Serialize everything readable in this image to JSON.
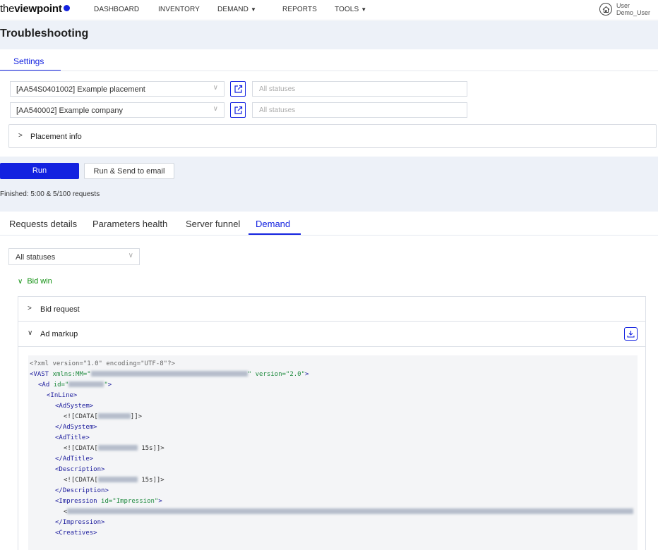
{
  "nav": {
    "logo_pre": "the",
    "logo_bold": "viewpoint",
    "items": [
      "DASHBOARD",
      "INVENTORY",
      "DEMAND",
      "REPORTS",
      "TOOLS"
    ],
    "user_label": "User",
    "user_name": "Demo_User"
  },
  "page": {
    "title": "Troubleshooting"
  },
  "settings": {
    "tab": "Settings",
    "placement_select": "[AA54S0401002] Example placement",
    "placement_status_placeholder": "All statuses",
    "company_select": "[AA540002] Example company",
    "company_status_placeholder": "All statuses",
    "placement_info": "Placement info"
  },
  "actions": {
    "run": "Run",
    "run_send": "Run & Send to email",
    "finished": "Finished: 5:00 & 5/100 requests"
  },
  "result_tabs": [
    "Requests details",
    "Parameters health",
    "Server funnel",
    "Demand"
  ],
  "active_tab": "Demand",
  "demand": {
    "status_filter": "All statuses",
    "group": "Bid win",
    "bid_request": "Bid request",
    "ad_markup": "Ad markup"
  },
  "code": {
    "xml_decl": "<?xml version=\"1.0\" encoding=\"UTF-8\"?>",
    "vast_open": "<VAST",
    "vast_attr1": "xmlns:MM=",
    "vast_attr2": "version=",
    "vast_version": "\"2.0\"",
    "ad_open": "<Ad",
    "ad_attr": "id=",
    "inline_open": "<InLine>",
    "adsystem_open": "<AdSystem>",
    "cdata_open": "<![CDATA[",
    "cdata_close": "]]>",
    "adsystem_close": "</AdSystem>",
    "adtitle_open": "<AdTitle>",
    "adtitle_suffix": " 15s]]>",
    "adtitle_close": "</AdTitle>",
    "description_open": "<Description>",
    "description_suffix": " 15s]]>",
    "description_close": "</Description>",
    "impression_open": "<Impression",
    "impression_attr": "id=",
    "impression_id": "\"Impression\"",
    "impression_close": "</Impression>",
    "creatives_open": "<Creatives>"
  },
  "icons": {
    "nav_dropdown": "caret-down-icon",
    "user": "home-icon",
    "external": "external-link-icon",
    "download": "download-icon",
    "chevron": "chevron-icon"
  },
  "colors": {
    "accent": "#1322e0",
    "band": "#edf1f8",
    "bid_win": "#109010"
  }
}
